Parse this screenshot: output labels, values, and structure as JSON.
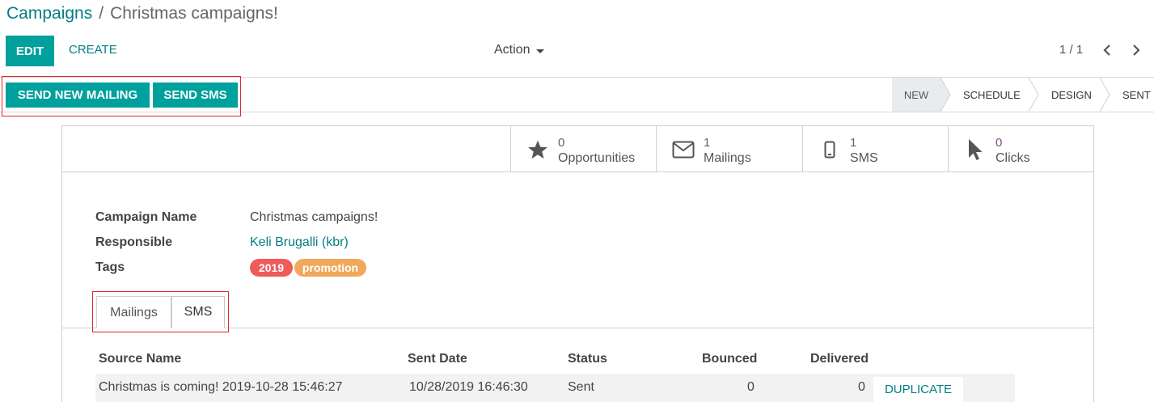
{
  "breadcrumb": {
    "parent": "Campaigns",
    "separator": "/",
    "current": "Christmas campaigns!"
  },
  "control_panel": {
    "edit_label": "EDIT",
    "create_label": "CREATE",
    "action_label": "Action",
    "pager": "1 / 1"
  },
  "header": {
    "send_mailing_label": "SEND NEW MAILING",
    "send_sms_label": "SEND SMS",
    "stages": [
      "NEW",
      "SCHEDULE",
      "DESIGN",
      "SENT"
    ],
    "active_stage": "NEW"
  },
  "stat_buttons": [
    {
      "value": "0",
      "label": "Opportunities",
      "icon": "star-icon"
    },
    {
      "value": "1",
      "label": "Mailings",
      "icon": "envelope-icon"
    },
    {
      "value": "1",
      "label": "SMS",
      "icon": "mobile-icon"
    },
    {
      "value": "0",
      "label": "Clicks",
      "icon": "cursor-icon"
    }
  ],
  "fields": {
    "campaign_name_label": "Campaign Name",
    "campaign_name": "Christmas campaigns!",
    "responsible_label": "Responsible",
    "responsible": "Keli Brugalli (kbr)",
    "tags_label": "Tags",
    "tags": [
      "2019",
      "promotion"
    ]
  },
  "tabs": [
    {
      "label": "Mailings",
      "active": false
    },
    {
      "label": "SMS",
      "active": true
    }
  ],
  "table": {
    "columns": [
      "Source Name",
      "Sent Date",
      "Status",
      "Bounced",
      "Delivered"
    ],
    "rows": [
      {
        "source_name": "Christmas is coming! 2019-10-28 15:46:27",
        "sent_date": "10/28/2019 16:46:30",
        "status": "Sent",
        "bounced": "0",
        "delivered": "0",
        "action": "DUPLICATE"
      }
    ]
  },
  "colors": {
    "primary": "#00a09d",
    "link": "#017e84",
    "highlight": "#e0262c",
    "tag_2019": "#ef5a5a",
    "tag_promotion": "#f0a85c",
    "stat_value": "#7c4f7c"
  }
}
